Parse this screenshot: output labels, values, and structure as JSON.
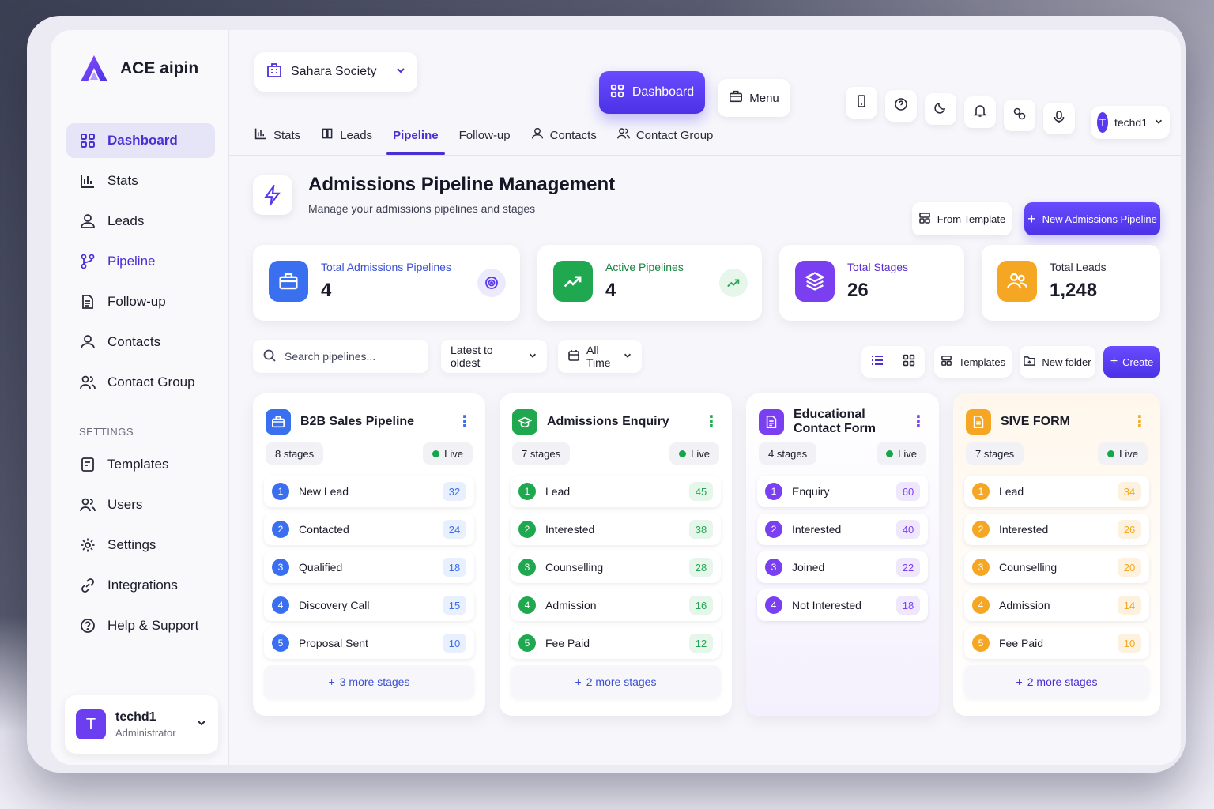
{
  "app": {
    "name": "ACE aipin"
  },
  "sidebar": {
    "items": [
      {
        "label": "Dashboard",
        "icon": "grid-icon",
        "active": true
      },
      {
        "label": "Stats",
        "icon": "bar-chart-icon"
      },
      {
        "label": "Leads",
        "icon": "user-icon"
      },
      {
        "label": "Pipeline",
        "icon": "pipeline-icon"
      },
      {
        "label": "Follow-up",
        "icon": "document-icon"
      },
      {
        "label": "Contacts",
        "icon": "contacts-icon"
      },
      {
        "label": "Contact Group",
        "icon": "users-icon"
      }
    ],
    "settings_label": "SETTINGS",
    "settings_items": [
      {
        "label": "Templates",
        "icon": "template-icon"
      },
      {
        "label": "Users",
        "icon": "users-icon"
      },
      {
        "label": "Settings",
        "icon": "gear-icon"
      },
      {
        "label": "Integrations",
        "icon": "link-icon"
      },
      {
        "label": "Help & Support",
        "icon": "help-icon"
      }
    ],
    "user": {
      "initial": "T",
      "name": "techd1",
      "role": "Administrator"
    }
  },
  "topbar": {
    "org": "Sahara Society",
    "dashboard_label": "Dashboard",
    "menu_label": "Menu",
    "user": {
      "initial": "T",
      "name": "techd1"
    }
  },
  "tabs": [
    {
      "label": "Stats"
    },
    {
      "label": "Leads"
    },
    {
      "label": "Pipeline",
      "active": true
    },
    {
      "label": "Follow-up"
    },
    {
      "label": "Contacts"
    },
    {
      "label": "Contact Group"
    }
  ],
  "header": {
    "title": "Admissions Pipeline Management",
    "subtitle": "Manage your admissions pipelines and stages",
    "from_template": "From Template",
    "new_pipeline": "New Admissions Pipeline"
  },
  "stats": [
    {
      "label": "Total Admissions Pipelines",
      "value": "4",
      "color": "#3a6ff0"
    },
    {
      "label": "Active Pipelines",
      "value": "4",
      "color": "#1fa84f"
    },
    {
      "label": "Total Stages",
      "value": "26",
      "color": "#7a3ff0"
    },
    {
      "label": "Total Leads",
      "value": "1,248",
      "color": "#f5a623"
    }
  ],
  "toolbar": {
    "search_placeholder": "Search pipelines...",
    "sort": "Latest to oldest",
    "range": "All Time",
    "templates": "Templates",
    "new_folder": "New folder",
    "create": "Create"
  },
  "pipelines": [
    {
      "name": "B2B Sales Pipeline",
      "stages_count": "8 stages",
      "status": "Live",
      "color": "#3a6ff0",
      "badge_bg": "#e8effe",
      "stages": [
        {
          "n": "1",
          "label": "New Lead",
          "count": "32"
        },
        {
          "n": "2",
          "label": "Contacted",
          "count": "24"
        },
        {
          "n": "3",
          "label": "Qualified",
          "count": "18"
        },
        {
          "n": "4",
          "label": "Discovery Call",
          "count": "15"
        },
        {
          "n": "5",
          "label": "Proposal Sent",
          "count": "10"
        }
      ],
      "more": "3 more stages"
    },
    {
      "name": "Admissions Enquiry",
      "stages_count": "7 stages",
      "status": "Live",
      "color": "#1fa84f",
      "badge_bg": "#e6f6ea",
      "stages": [
        {
          "n": "1",
          "label": "Lead",
          "count": "45"
        },
        {
          "n": "2",
          "label": "Interested",
          "count": "38"
        },
        {
          "n": "3",
          "label": "Counselling",
          "count": "28"
        },
        {
          "n": "4",
          "label": "Admission",
          "count": "16"
        },
        {
          "n": "5",
          "label": "Fee Paid",
          "count": "12"
        }
      ],
      "more": "2 more stages"
    },
    {
      "name": "Educational Contact Form",
      "stages_count": "4 stages",
      "status": "Live",
      "color": "#7a3ff0",
      "badge_bg": "#efe8fd",
      "stages": [
        {
          "n": "1",
          "label": "Enquiry",
          "count": "60"
        },
        {
          "n": "2",
          "label": "Interested",
          "count": "40"
        },
        {
          "n": "3",
          "label": "Joined",
          "count": "22"
        },
        {
          "n": "4",
          "label": "Not Interested",
          "count": "18"
        }
      ]
    },
    {
      "name": "SIVE FORM",
      "stages_count": "7 stages",
      "status": "Live",
      "color": "#f5a623",
      "badge_bg": "#fdf2df",
      "stages": [
        {
          "n": "1",
          "label": "Lead",
          "count": "34"
        },
        {
          "n": "2",
          "label": "Interested",
          "count": "26"
        },
        {
          "n": "3",
          "label": "Counselling",
          "count": "20"
        },
        {
          "n": "4",
          "label": "Admission",
          "count": "14"
        },
        {
          "n": "5",
          "label": "Fee Paid",
          "count": "10"
        }
      ],
      "more": "2 more stages"
    }
  ]
}
